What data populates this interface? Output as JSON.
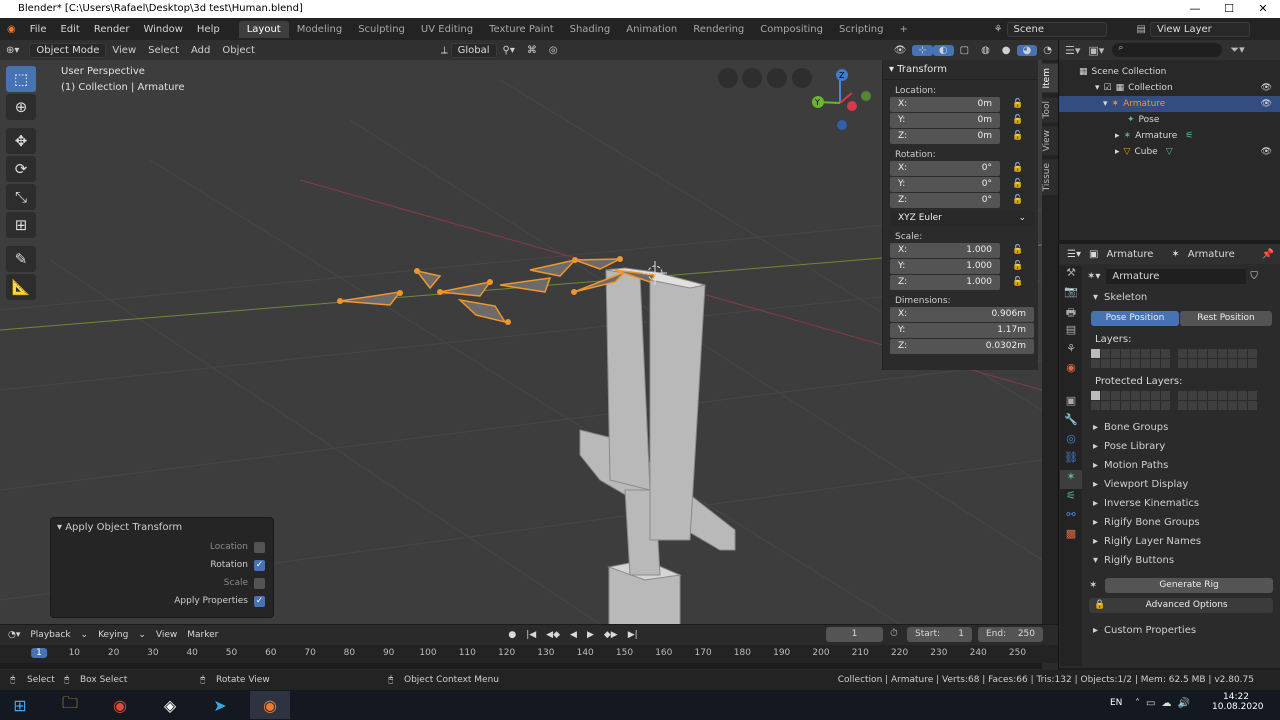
{
  "window": {
    "title": "Blender* [C:\\Users\\Rafael\\Desktop\\3d test\\Human.blend]"
  },
  "menu": [
    "File",
    "Edit",
    "Render",
    "Window",
    "Help"
  ],
  "workspaces": [
    "Layout",
    "Modeling",
    "Sculpting",
    "UV Editing",
    "Texture Paint",
    "Shading",
    "Animation",
    "Rendering",
    "Compositing",
    "Scripting"
  ],
  "active_workspace": "Layout",
  "scene": {
    "name": "Scene",
    "view_layer": "View Layer"
  },
  "viewport_header": {
    "mode": "Object Mode",
    "view": "View",
    "select": "Select",
    "add": "Add",
    "object": "Object",
    "orientation": "Global"
  },
  "viewport": {
    "perspective": "User Perspective",
    "collection_info": "(1) Collection | Armature"
  },
  "transform": {
    "title": "Transform",
    "location_label": "Location:",
    "location": [
      {
        "axis": "X:",
        "value": "0m"
      },
      {
        "axis": "Y:",
        "value": "0m"
      },
      {
        "axis": "Z:",
        "value": "0m"
      }
    ],
    "rotation_label": "Rotation:",
    "rotation": [
      {
        "axis": "X:",
        "value": "0°"
      },
      {
        "axis": "Y:",
        "value": "0°"
      },
      {
        "axis": "Z:",
        "value": "0°"
      }
    ],
    "rotation_mode": "XYZ Euler",
    "scale_label": "Scale:",
    "scale": [
      {
        "axis": "X:",
        "value": "1.000"
      },
      {
        "axis": "Y:",
        "value": "1.000"
      },
      {
        "axis": "Z:",
        "value": "1.000"
      }
    ],
    "dimensions_label": "Dimensions:",
    "dimensions": [
      {
        "axis": "X:",
        "value": "0.906m"
      },
      {
        "axis": "Y:",
        "value": "1.17m"
      },
      {
        "axis": "Z:",
        "value": "0.0302m"
      }
    ]
  },
  "npanel_tabs": [
    "Item",
    "Tool",
    "View",
    "Tissue"
  ],
  "redo_panel": {
    "title": "Apply Object Transform",
    "options": [
      {
        "label": "Location",
        "checked": false
      },
      {
        "label": "Rotation",
        "checked": true
      },
      {
        "label": "Scale",
        "checked": false
      },
      {
        "label": "Apply Properties",
        "checked": true
      }
    ]
  },
  "outliner": {
    "root": "Scene Collection",
    "items": [
      {
        "label": "Collection",
        "indent": 1
      },
      {
        "label": "Armature",
        "indent": 2,
        "selected": true
      },
      {
        "label": "Pose",
        "indent": 3
      },
      {
        "label": "Armature",
        "indent": 3
      },
      {
        "label": "Cube",
        "indent": 3
      }
    ]
  },
  "properties": {
    "header_object": "Armature",
    "header_data": "Armature",
    "datablock": "Armature",
    "skeleton_title": "Skeleton",
    "pose_position": "Pose Position",
    "rest_position": "Rest Position",
    "layers_label": "Layers:",
    "protected_layers_label": "Protected Layers:",
    "sections": [
      "Bone Groups",
      "Pose Library",
      "Motion Paths",
      "Viewport Display",
      "Inverse Kinematics",
      "Rigify Bone Groups",
      "Rigify Layer Names"
    ],
    "rigify_buttons": "Rigify Buttons",
    "generate_rig": "Generate Rig",
    "advanced_options": "Advanced Options",
    "custom_properties": "Custom Properties"
  },
  "timeline": {
    "playback": "Playback",
    "keying": "Keying",
    "view": "View",
    "marker": "Marker",
    "current_frame": "1",
    "start_label": "Start:",
    "start": "1",
    "end_label": "End:",
    "end": "250",
    "ruler": [
      "1",
      "10",
      "20",
      "30",
      "40",
      "50",
      "60",
      "70",
      "80",
      "90",
      "100",
      "110",
      "120",
      "130",
      "140",
      "150",
      "160",
      "170",
      "180",
      "190",
      "200",
      "210",
      "220",
      "230",
      "240",
      "250"
    ]
  },
  "statusbar": {
    "select": "Select",
    "box_select": "Box Select",
    "rotate_view": "Rotate View",
    "context_menu": "Object Context Menu",
    "stats": "Collection | Armature | Verts:68 | Faces:66 | Tris:132 | Objects:1/2 | Mem: 62.5 MB | v2.80.75"
  },
  "taskbar": {
    "lang": "EN",
    "time": "14:22",
    "date": "10.08.2020"
  },
  "colors": {
    "accent": "#4772b3",
    "select_orange": "#f0962d",
    "viewport_bg": "#3d3d3d"
  }
}
